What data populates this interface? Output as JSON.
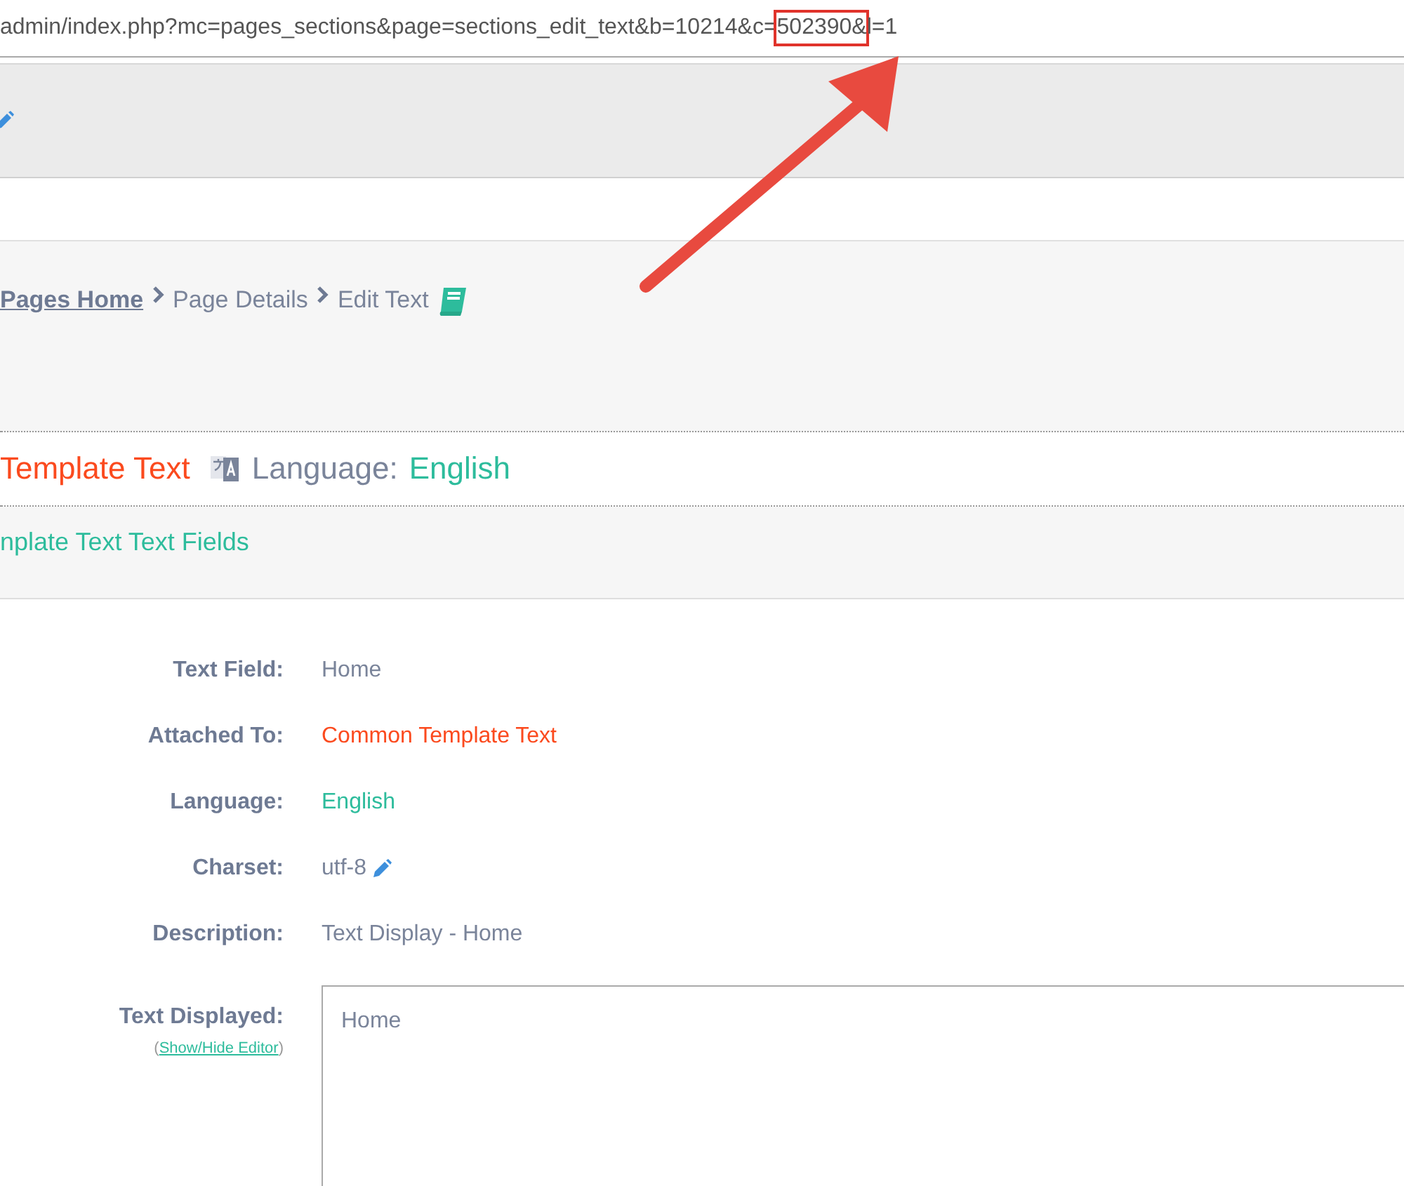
{
  "url": {
    "start": "admin/index.php?mc=pages_sections&page=sections_edit_text&b=10214&c=",
    "highlighted": "502390&",
    "end": "l=1"
  },
  "breadcrumb": [
    {
      "label": "Pages Home",
      "kind": "link"
    },
    {
      "label": "Page Details",
      "kind": "text"
    },
    {
      "label": "Edit Text",
      "kind": "text"
    }
  ],
  "heading": {
    "title": "Template Text",
    "language_label": "Language:",
    "language": "English"
  },
  "section_title": "nplate Text Text Fields",
  "fields": [
    {
      "label": "Text Field:",
      "value": "Home",
      "kind": "plain"
    },
    {
      "label": "Attached To:",
      "value": "Common Template Text",
      "kind": "template"
    },
    {
      "label": "Language:",
      "value": "English",
      "kind": "language"
    },
    {
      "label": "Charset:",
      "value": "utf-8",
      "kind": "editable"
    },
    {
      "label": "Description:",
      "value": "Text Display - Home",
      "kind": "plain"
    }
  ],
  "text_displayed": {
    "label": "Text Displayed:",
    "open_paren": "(",
    "toggle_link": "Show/Hide Editor",
    "close_paren": ")",
    "value": "Home"
  }
}
